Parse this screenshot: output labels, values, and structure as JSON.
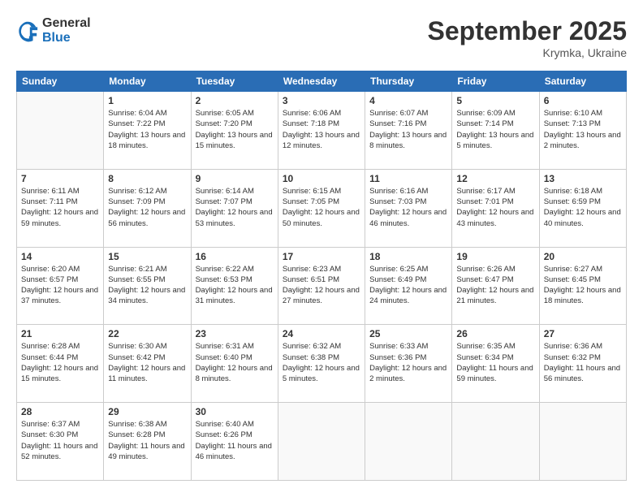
{
  "logo": {
    "general": "General",
    "blue": "Blue"
  },
  "header": {
    "month_year": "September 2025",
    "location": "Krymka, Ukraine"
  },
  "weekdays": [
    "Sunday",
    "Monday",
    "Tuesday",
    "Wednesday",
    "Thursday",
    "Friday",
    "Saturday"
  ],
  "weeks": [
    [
      {
        "day": "",
        "sunrise": "",
        "sunset": "",
        "daylight": ""
      },
      {
        "day": "1",
        "sunrise": "Sunrise: 6:04 AM",
        "sunset": "Sunset: 7:22 PM",
        "daylight": "Daylight: 13 hours and 18 minutes."
      },
      {
        "day": "2",
        "sunrise": "Sunrise: 6:05 AM",
        "sunset": "Sunset: 7:20 PM",
        "daylight": "Daylight: 13 hours and 15 minutes."
      },
      {
        "day": "3",
        "sunrise": "Sunrise: 6:06 AM",
        "sunset": "Sunset: 7:18 PM",
        "daylight": "Daylight: 13 hours and 12 minutes."
      },
      {
        "day": "4",
        "sunrise": "Sunrise: 6:07 AM",
        "sunset": "Sunset: 7:16 PM",
        "daylight": "Daylight: 13 hours and 8 minutes."
      },
      {
        "day": "5",
        "sunrise": "Sunrise: 6:09 AM",
        "sunset": "Sunset: 7:14 PM",
        "daylight": "Daylight: 13 hours and 5 minutes."
      },
      {
        "day": "6",
        "sunrise": "Sunrise: 6:10 AM",
        "sunset": "Sunset: 7:13 PM",
        "daylight": "Daylight: 13 hours and 2 minutes."
      }
    ],
    [
      {
        "day": "7",
        "sunrise": "Sunrise: 6:11 AM",
        "sunset": "Sunset: 7:11 PM",
        "daylight": "Daylight: 12 hours and 59 minutes."
      },
      {
        "day": "8",
        "sunrise": "Sunrise: 6:12 AM",
        "sunset": "Sunset: 7:09 PM",
        "daylight": "Daylight: 12 hours and 56 minutes."
      },
      {
        "day": "9",
        "sunrise": "Sunrise: 6:14 AM",
        "sunset": "Sunset: 7:07 PM",
        "daylight": "Daylight: 12 hours and 53 minutes."
      },
      {
        "day": "10",
        "sunrise": "Sunrise: 6:15 AM",
        "sunset": "Sunset: 7:05 PM",
        "daylight": "Daylight: 12 hours and 50 minutes."
      },
      {
        "day": "11",
        "sunrise": "Sunrise: 6:16 AM",
        "sunset": "Sunset: 7:03 PM",
        "daylight": "Daylight: 12 hours and 46 minutes."
      },
      {
        "day": "12",
        "sunrise": "Sunrise: 6:17 AM",
        "sunset": "Sunset: 7:01 PM",
        "daylight": "Daylight: 12 hours and 43 minutes."
      },
      {
        "day": "13",
        "sunrise": "Sunrise: 6:18 AM",
        "sunset": "Sunset: 6:59 PM",
        "daylight": "Daylight: 12 hours and 40 minutes."
      }
    ],
    [
      {
        "day": "14",
        "sunrise": "Sunrise: 6:20 AM",
        "sunset": "Sunset: 6:57 PM",
        "daylight": "Daylight: 12 hours and 37 minutes."
      },
      {
        "day": "15",
        "sunrise": "Sunrise: 6:21 AM",
        "sunset": "Sunset: 6:55 PM",
        "daylight": "Daylight: 12 hours and 34 minutes."
      },
      {
        "day": "16",
        "sunrise": "Sunrise: 6:22 AM",
        "sunset": "Sunset: 6:53 PM",
        "daylight": "Daylight: 12 hours and 31 minutes."
      },
      {
        "day": "17",
        "sunrise": "Sunrise: 6:23 AM",
        "sunset": "Sunset: 6:51 PM",
        "daylight": "Daylight: 12 hours and 27 minutes."
      },
      {
        "day": "18",
        "sunrise": "Sunrise: 6:25 AM",
        "sunset": "Sunset: 6:49 PM",
        "daylight": "Daylight: 12 hours and 24 minutes."
      },
      {
        "day": "19",
        "sunrise": "Sunrise: 6:26 AM",
        "sunset": "Sunset: 6:47 PM",
        "daylight": "Daylight: 12 hours and 21 minutes."
      },
      {
        "day": "20",
        "sunrise": "Sunrise: 6:27 AM",
        "sunset": "Sunset: 6:45 PM",
        "daylight": "Daylight: 12 hours and 18 minutes."
      }
    ],
    [
      {
        "day": "21",
        "sunrise": "Sunrise: 6:28 AM",
        "sunset": "Sunset: 6:44 PM",
        "daylight": "Daylight: 12 hours and 15 minutes."
      },
      {
        "day": "22",
        "sunrise": "Sunrise: 6:30 AM",
        "sunset": "Sunset: 6:42 PM",
        "daylight": "Daylight: 12 hours and 11 minutes."
      },
      {
        "day": "23",
        "sunrise": "Sunrise: 6:31 AM",
        "sunset": "Sunset: 6:40 PM",
        "daylight": "Daylight: 12 hours and 8 minutes."
      },
      {
        "day": "24",
        "sunrise": "Sunrise: 6:32 AM",
        "sunset": "Sunset: 6:38 PM",
        "daylight": "Daylight: 12 hours and 5 minutes."
      },
      {
        "day": "25",
        "sunrise": "Sunrise: 6:33 AM",
        "sunset": "Sunset: 6:36 PM",
        "daylight": "Daylight: 12 hours and 2 minutes."
      },
      {
        "day": "26",
        "sunrise": "Sunrise: 6:35 AM",
        "sunset": "Sunset: 6:34 PM",
        "daylight": "Daylight: 11 hours and 59 minutes."
      },
      {
        "day": "27",
        "sunrise": "Sunrise: 6:36 AM",
        "sunset": "Sunset: 6:32 PM",
        "daylight": "Daylight: 11 hours and 56 minutes."
      }
    ],
    [
      {
        "day": "28",
        "sunrise": "Sunrise: 6:37 AM",
        "sunset": "Sunset: 6:30 PM",
        "daylight": "Daylight: 11 hours and 52 minutes."
      },
      {
        "day": "29",
        "sunrise": "Sunrise: 6:38 AM",
        "sunset": "Sunset: 6:28 PM",
        "daylight": "Daylight: 11 hours and 49 minutes."
      },
      {
        "day": "30",
        "sunrise": "Sunrise: 6:40 AM",
        "sunset": "Sunset: 6:26 PM",
        "daylight": "Daylight: 11 hours and 46 minutes."
      },
      {
        "day": "",
        "sunrise": "",
        "sunset": "",
        "daylight": ""
      },
      {
        "day": "",
        "sunrise": "",
        "sunset": "",
        "daylight": ""
      },
      {
        "day": "",
        "sunrise": "",
        "sunset": "",
        "daylight": ""
      },
      {
        "day": "",
        "sunrise": "",
        "sunset": "",
        "daylight": ""
      }
    ]
  ]
}
